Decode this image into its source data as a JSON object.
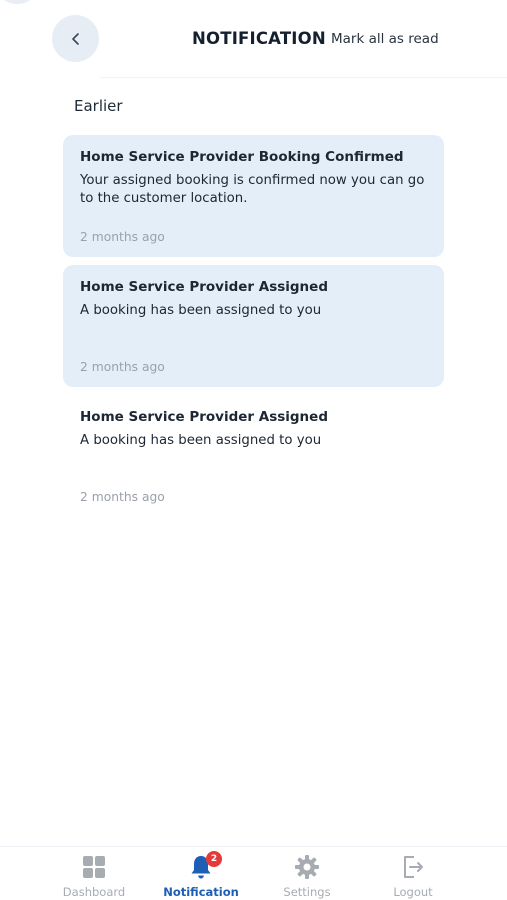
{
  "header": {
    "title": "NOTIFICATION",
    "mark_all_read": "Mark all as read"
  },
  "section": {
    "label": "Earlier"
  },
  "notifications": [
    {
      "title": "Home Service Provider Booking Confirmed",
      "body": "Your assigned booking is confirmed now you can go to the customer location.",
      "time": "2 months ago",
      "unread": true
    },
    {
      "title": "Home Service Provider Assigned",
      "body": "A booking has been assigned to you",
      "time": "2 months ago",
      "unread": true
    },
    {
      "title": "Home Service Provider Assigned",
      "body": "A booking has been assigned to you",
      "time": "2 months ago",
      "unread": false
    }
  ],
  "bottom_nav": {
    "items": [
      {
        "label": "Dashboard",
        "icon": "grid-icon",
        "active": false
      },
      {
        "label": "Notification",
        "icon": "bell-icon",
        "active": true,
        "badge": "2"
      },
      {
        "label": "Settings",
        "icon": "gear-icon",
        "active": false
      },
      {
        "label": "Logout",
        "icon": "logout-icon",
        "active": false
      }
    ]
  },
  "colors": {
    "accent": "#1d5fb5",
    "unread_card": "#e4eef9",
    "badge": "#e53a3a",
    "muted": "#a7acb3"
  }
}
